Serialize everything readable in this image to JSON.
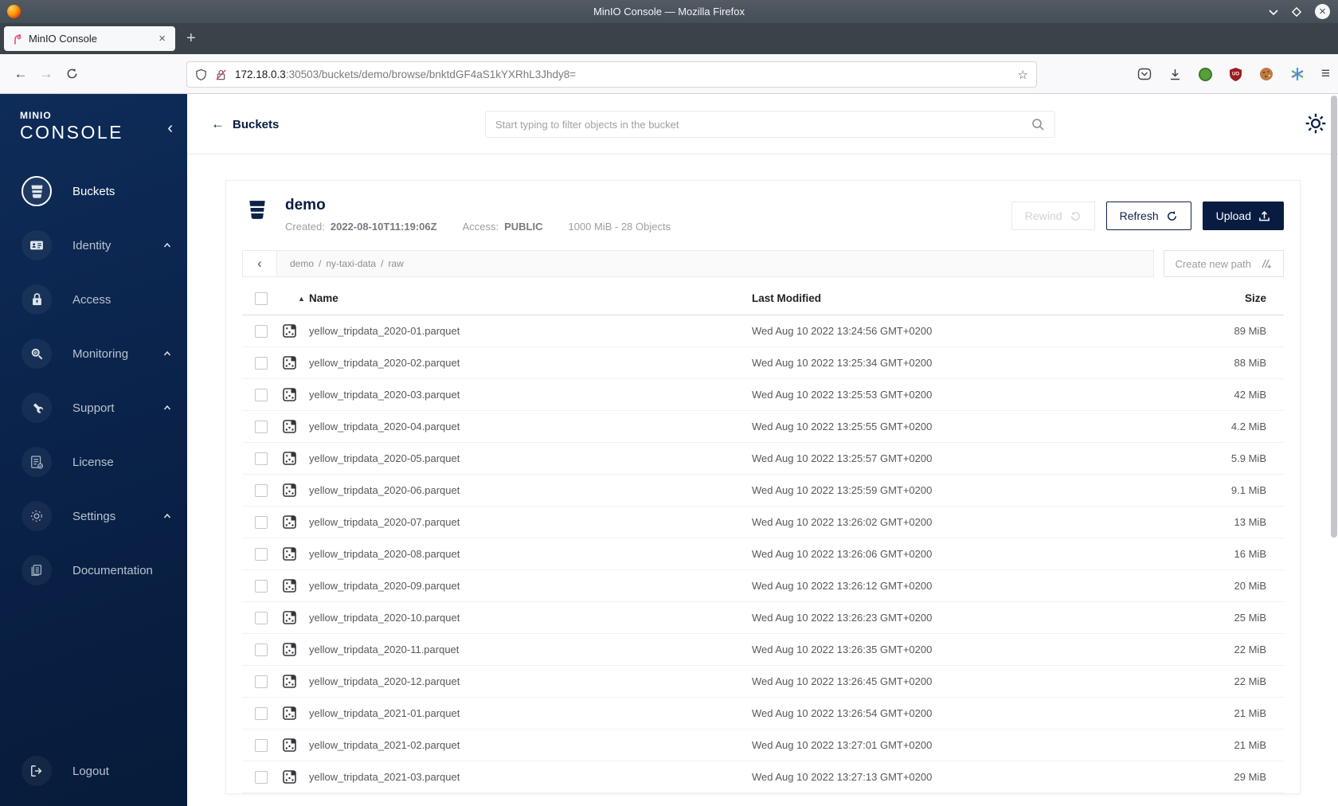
{
  "window": {
    "title": "MinIO Console — Mozilla Firefox"
  },
  "browser_chrome": {
    "tab_title": "MinIO Console",
    "new_tab": "+",
    "url_host": "172.18.0.3",
    "url_path": ":30503/buckets/demo/browse/bnktdGF4aS1kYXRhL3Jhdy8="
  },
  "sidebar": {
    "logo_small": "MINIO",
    "logo_large": "CONSOLE",
    "items": [
      {
        "id": "buckets",
        "label": "Buckets",
        "icon": "bucket-icon",
        "caret": false,
        "active": true
      },
      {
        "id": "identity",
        "label": "Identity",
        "icon": "identity-icon",
        "caret": true,
        "active": false
      },
      {
        "id": "access",
        "label": "Access",
        "icon": "lock-icon",
        "caret": false,
        "active": false
      },
      {
        "id": "monitoring",
        "label": "Monitoring",
        "icon": "monitor-icon",
        "caret": true,
        "active": false
      },
      {
        "id": "support",
        "label": "Support",
        "icon": "wrench-icon",
        "caret": true,
        "active": false
      },
      {
        "id": "license",
        "label": "License",
        "icon": "license-icon",
        "caret": false,
        "active": false
      },
      {
        "id": "settings",
        "label": "Settings",
        "icon": "gear-icon",
        "caret": true,
        "active": false
      },
      {
        "id": "documentation",
        "label": "Documentation",
        "icon": "docs-icon",
        "caret": false,
        "active": false
      }
    ],
    "logout": {
      "id": "logout",
      "label": "Logout",
      "icon": "logout-icon"
    }
  },
  "topbar": {
    "back_label": "Buckets",
    "search_placeholder": "Start typing to filter objects in the bucket"
  },
  "bucket": {
    "name": "demo",
    "created_label": "Created:",
    "created_value": "2022-08-10T11:19:06Z",
    "access_label": "Access:",
    "access_value": "PUBLIC",
    "stats": "1000 MiB - 28 Objects",
    "rewind_label": "Rewind",
    "refresh_label": "Refresh",
    "upload_label": "Upload"
  },
  "path_bar": {
    "segments": [
      "demo",
      "ny-taxi-data",
      "raw"
    ],
    "separator": "/",
    "create_label": "Create new path"
  },
  "table": {
    "headers": {
      "name": "Name",
      "modified": "Last Modified",
      "size": "Size"
    },
    "rows": [
      {
        "name": "yellow_tripdata_2020-01.parquet",
        "modified": "Wed Aug 10 2022 13:24:56 GMT+0200",
        "size": "89 MiB"
      },
      {
        "name": "yellow_tripdata_2020-02.parquet",
        "modified": "Wed Aug 10 2022 13:25:34 GMT+0200",
        "size": "88 MiB"
      },
      {
        "name": "yellow_tripdata_2020-03.parquet",
        "modified": "Wed Aug 10 2022 13:25:53 GMT+0200",
        "size": "42 MiB"
      },
      {
        "name": "yellow_tripdata_2020-04.parquet",
        "modified": "Wed Aug 10 2022 13:25:55 GMT+0200",
        "size": "4.2 MiB"
      },
      {
        "name": "yellow_tripdata_2020-05.parquet",
        "modified": "Wed Aug 10 2022 13:25:57 GMT+0200",
        "size": "5.9 MiB"
      },
      {
        "name": "yellow_tripdata_2020-06.parquet",
        "modified": "Wed Aug 10 2022 13:25:59 GMT+0200",
        "size": "9.1 MiB"
      },
      {
        "name": "yellow_tripdata_2020-07.parquet",
        "modified": "Wed Aug 10 2022 13:26:02 GMT+0200",
        "size": "13 MiB"
      },
      {
        "name": "yellow_tripdata_2020-08.parquet",
        "modified": "Wed Aug 10 2022 13:26:06 GMT+0200",
        "size": "16 MiB"
      },
      {
        "name": "yellow_tripdata_2020-09.parquet",
        "modified": "Wed Aug 10 2022 13:26:12 GMT+0200",
        "size": "20 MiB"
      },
      {
        "name": "yellow_tripdata_2020-10.parquet",
        "modified": "Wed Aug 10 2022 13:26:23 GMT+0200",
        "size": "25 MiB"
      },
      {
        "name": "yellow_tripdata_2020-11.parquet",
        "modified": "Wed Aug 10 2022 13:26:35 GMT+0200",
        "size": "22 MiB"
      },
      {
        "name": "yellow_tripdata_2020-12.parquet",
        "modified": "Wed Aug 10 2022 13:26:45 GMT+0200",
        "size": "22 MiB"
      },
      {
        "name": "yellow_tripdata_2021-01.parquet",
        "modified": "Wed Aug 10 2022 13:26:54 GMT+0200",
        "size": "21 MiB"
      },
      {
        "name": "yellow_tripdata_2021-02.parquet",
        "modified": "Wed Aug 10 2022 13:27:01 GMT+0200",
        "size": "21 MiB"
      },
      {
        "name": "yellow_tripdata_2021-03.parquet",
        "modified": "Wed Aug 10 2022 13:27:13 GMT+0200",
        "size": "29 MiB"
      }
    ]
  },
  "colors": {
    "navy": "#081C42",
    "sidebar_top": "#0e2c59",
    "sidebar_bottom": "#071b3a",
    "titlebar": "#4b545c",
    "accent_red": "#d7373f"
  }
}
